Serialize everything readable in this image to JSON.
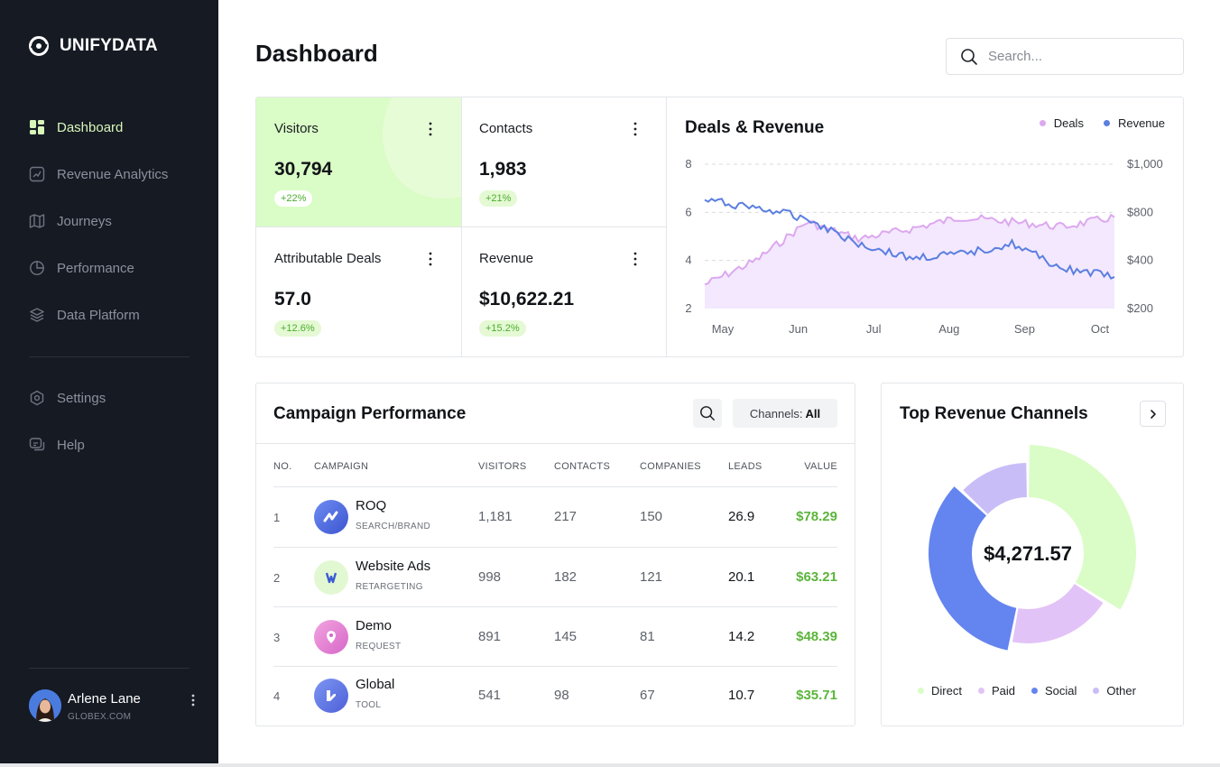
{
  "brand": {
    "name": "UNIFYDATA"
  },
  "sidebar": {
    "items": [
      {
        "label": "Dashboard",
        "icon": "grid-icon",
        "active": true
      },
      {
        "label": "Revenue Analytics",
        "icon": "chart-icon",
        "active": false
      },
      {
        "label": "Journeys",
        "icon": "map-icon",
        "active": false
      },
      {
        "label": "Performance",
        "icon": "pie-icon",
        "active": false
      },
      {
        "label": "Data Platform",
        "icon": "layers-icon",
        "active": false
      }
    ],
    "secondary": [
      {
        "label": "Settings",
        "icon": "gear-icon"
      },
      {
        "label": "Help",
        "icon": "help-chat-icon"
      }
    ],
    "user": {
      "name": "Arlene Lane",
      "org": "GLOBEX.COM"
    }
  },
  "header": {
    "title": "Dashboard",
    "search_placeholder": "Search..."
  },
  "stats": [
    {
      "title": "Visitors",
      "value": "30,794",
      "change": "+22%"
    },
    {
      "title": "Contacts",
      "value": "1,983",
      "change": "+21%"
    },
    {
      "title": "Attributable Deals",
      "value": "57.0",
      "change": "+12.6%"
    },
    {
      "title": "Revenue",
      "value": "$10,622.21",
      "change": "+15.2%"
    }
  ],
  "deals_chart": {
    "title": "Deals & Revenue",
    "legend": [
      "Deals",
      "Revenue"
    ],
    "left_ticks": [
      "8",
      "6",
      "4",
      "2"
    ],
    "right_ticks": [
      "$1,000",
      "$800",
      "$400",
      "$200"
    ],
    "x_ticks": [
      "May",
      "Jun",
      "Jul",
      "Aug",
      "Sep",
      "Oct"
    ]
  },
  "colors": {
    "deals": "#dca8ef",
    "revenue": "#5b7fe0",
    "accent_green": "#dafcc6",
    "value_green": "#5ab53a",
    "sidebar_bg": "#151a23"
  },
  "chart_data": [
    {
      "type": "area",
      "title": "Deals & Revenue",
      "x": [
        "May",
        "Jun",
        "Jul",
        "Aug",
        "Sep",
        "Oct"
      ],
      "series": [
        {
          "name": "Deals",
          "axis": "left",
          "values": [
            3.0,
            4.0,
            5.6,
            4.9,
            5.3,
            5.8,
            5.6,
            5.4,
            5.8
          ]
        },
        {
          "name": "Revenue",
          "axis": "right",
          "values": [
            800,
            760,
            700,
            560,
            480,
            500,
            560,
            420,
            380
          ]
        }
      ],
      "ylim_left": [
        2,
        8
      ],
      "ylim_right": [
        200,
        1000
      ],
      "grid": true,
      "legend": "top-right"
    },
    {
      "type": "pie",
      "title": "Top Revenue Channels",
      "center_label": "$4,271.57",
      "categories": [
        "Direct",
        "Paid",
        "Social",
        "Other"
      ],
      "values": [
        34,
        19,
        34,
        13
      ],
      "colors": [
        "#dafcc6",
        "#e2c3f7",
        "#6484ef",
        "#c9bdf7"
      ],
      "legend": "bottom"
    }
  ],
  "campaign": {
    "title": "Campaign Performance",
    "filter_label": "Channels:",
    "filter_value": "All",
    "columns": [
      "NO.",
      "CAMPAIGN",
      "VISITORS",
      "CONTACTS",
      "COMPANIES",
      "LEADS",
      "VALUE"
    ],
    "rows": [
      {
        "no": "1",
        "name": "ROQ",
        "sub": "SEARCH/BRAND",
        "visitors": "1,181",
        "contacts": "217",
        "companies": "150",
        "leads": "26.9",
        "value": "$78.29"
      },
      {
        "no": "2",
        "name": "Website Ads",
        "sub": "RETARGETING",
        "visitors": "998",
        "contacts": "182",
        "companies": "121",
        "leads": "20.1",
        "value": "$63.21"
      },
      {
        "no": "3",
        "name": "Demo",
        "sub": "REQUEST",
        "visitors": "891",
        "contacts": "145",
        "companies": "81",
        "leads": "14.2",
        "value": "$48.39"
      },
      {
        "no": "4",
        "name": "Global",
        "sub": "TOOL",
        "visitors": "541",
        "contacts": "98",
        "companies": "67",
        "leads": "10.7",
        "value": "$35.71"
      }
    ]
  },
  "channels": {
    "title": "Top Revenue Channels",
    "total": "$4,271.57",
    "legend": [
      "Direct",
      "Paid",
      "Social",
      "Other"
    ]
  }
}
